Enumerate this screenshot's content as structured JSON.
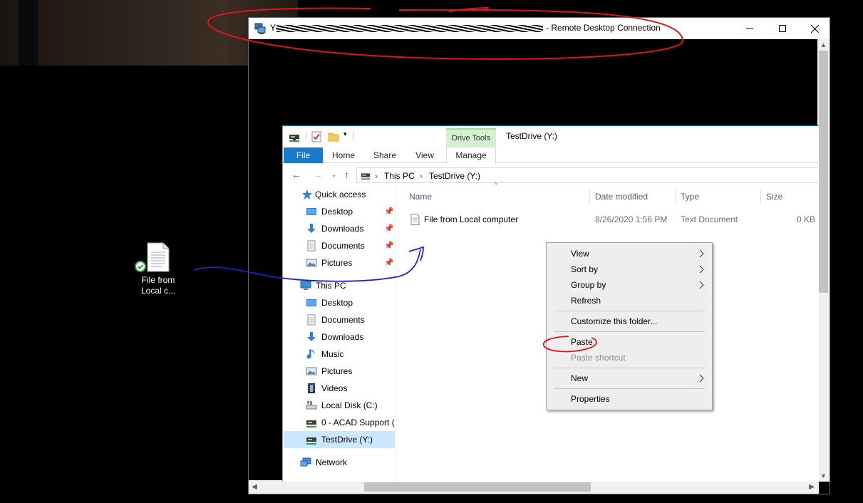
{
  "desktop": {
    "file_icon_label_line1": "File from",
    "file_icon_label_line2": "Local c..."
  },
  "rdp": {
    "title_suffix": "Remote Desktop Connection",
    "title_prefix_visible": "Y"
  },
  "explorer": {
    "window_title": "TestDrive (Y:)",
    "contextual_tab_group": "Drive Tools",
    "ribbon_tabs": {
      "file": "File",
      "home": "Home",
      "share": "Share",
      "view": "View",
      "manage": "Manage"
    },
    "breadcrumb": {
      "this_pc": "This PC",
      "drive": "TestDrive (Y:)"
    },
    "nav_pane": {
      "quick_access": "Quick access",
      "qa_desktop": "Desktop",
      "qa_downloads": "Downloads",
      "qa_documents": "Documents",
      "qa_pictures": "Pictures",
      "this_pc": "This PC",
      "pc_desktop": "Desktop",
      "pc_documents": "Documents",
      "pc_downloads": "Downloads",
      "pc_music": "Music",
      "pc_pictures": "Pictures",
      "pc_videos": "Videos",
      "local_disk": "Local Disk (C:)",
      "acad": "0 - ACAD Support (",
      "testdrive": "TestDrive (Y:)",
      "network": "Network"
    },
    "columns": {
      "name": "Name",
      "date": "Date modified",
      "type": "Type",
      "size": "Size"
    },
    "files": [
      {
        "name": "File from Local computer",
        "date": "8/26/2020 1:56 PM",
        "type": "Text Document",
        "size": "0 KB"
      }
    ]
  },
  "context_menu": {
    "view": "View",
    "sort_by": "Sort by",
    "group_by": "Group by",
    "refresh": "Refresh",
    "customize": "Customize this folder...",
    "paste": "Paste",
    "paste_shortcut": "Paste shortcut",
    "new": "New",
    "properties": "Properties"
  },
  "colors": {
    "file_tab": "#1979ca",
    "drive_tools": "#d6efcf",
    "selection": "#cce8ff",
    "annotation_red": "#e0141e",
    "annotation_blue": "#1a23c9"
  }
}
